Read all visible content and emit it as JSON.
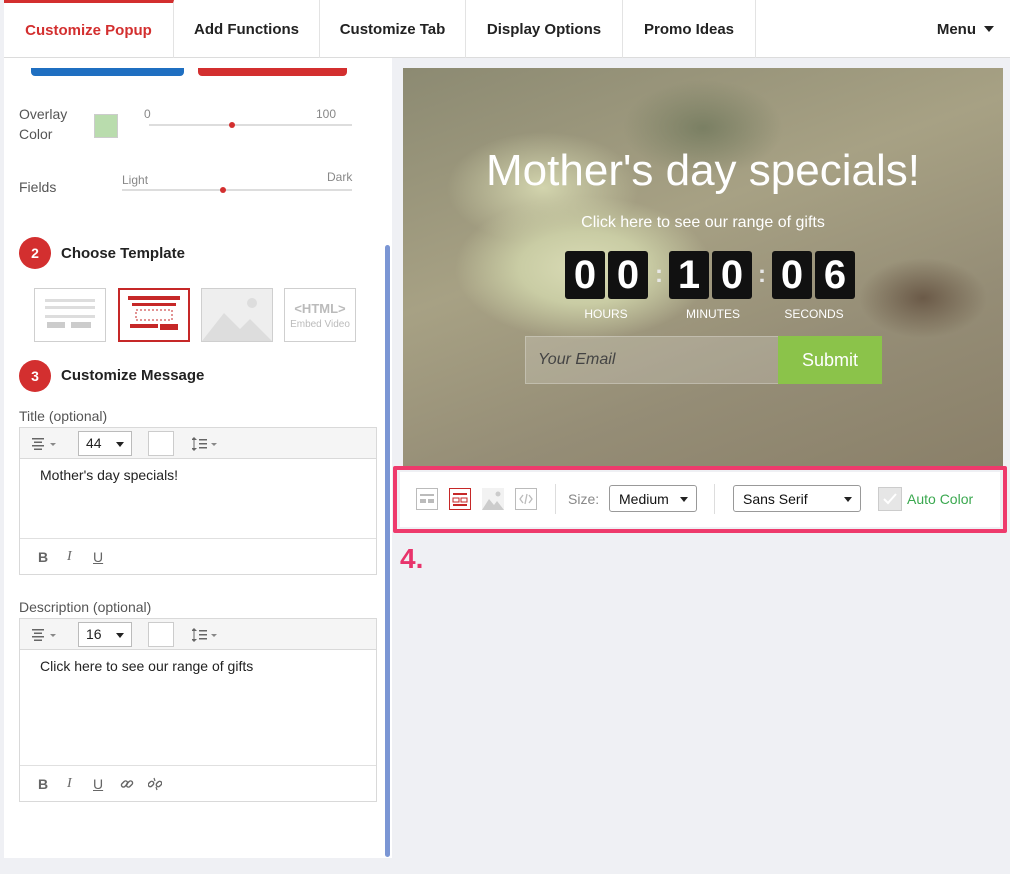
{
  "tabs": [
    {
      "label": "Customize Popup",
      "active": true
    },
    {
      "label": "Add Functions",
      "active": false
    },
    {
      "label": "Customize Tab",
      "active": false
    },
    {
      "label": "Display Options",
      "active": false
    },
    {
      "label": "Promo Ideas",
      "active": false
    }
  ],
  "menu_label": "Menu",
  "overlay": {
    "label": "Overlay Color",
    "color": "#b9dcad",
    "min": "0",
    "max": "100"
  },
  "fields": {
    "label": "Fields",
    "left": "Light",
    "right": "Dark"
  },
  "steps": {
    "template": {
      "number": "2",
      "title": "Choose Template"
    },
    "message": {
      "number": "3",
      "title": "Customize Message"
    }
  },
  "templates": {
    "html_label": "<HTML>",
    "html_sub": "Embed Video"
  },
  "title_editor": {
    "label": "Title (optional)",
    "size": "44",
    "text": "Mother's day specials!"
  },
  "desc_editor": {
    "label": "Description (optional)",
    "size": "16",
    "text": "Click here to see our range of gifts"
  },
  "format": {
    "bold": "B",
    "italic": "I",
    "underline": "U"
  },
  "preview": {
    "title": "Mother's day specials!",
    "description": "Click here to see our range of gifts",
    "digits": [
      "0",
      "0",
      "1",
      "0",
      "0",
      "6"
    ],
    "units": [
      "HOURS",
      "MINUTES",
      "SECONDS"
    ],
    "email_placeholder": "Your Email",
    "submit_label": "Submit",
    "submit_color": "#8bc34a"
  },
  "toolbar": {
    "size_label": "Size:",
    "size_value": "Medium",
    "font_value": "Sans Serif",
    "auto_color_label": "Auto Color"
  },
  "annotation": "4.",
  "colors": {
    "accent": "#d32f2f",
    "highlight": "#ee3a6c",
    "auto_color": "#3aa84f"
  }
}
